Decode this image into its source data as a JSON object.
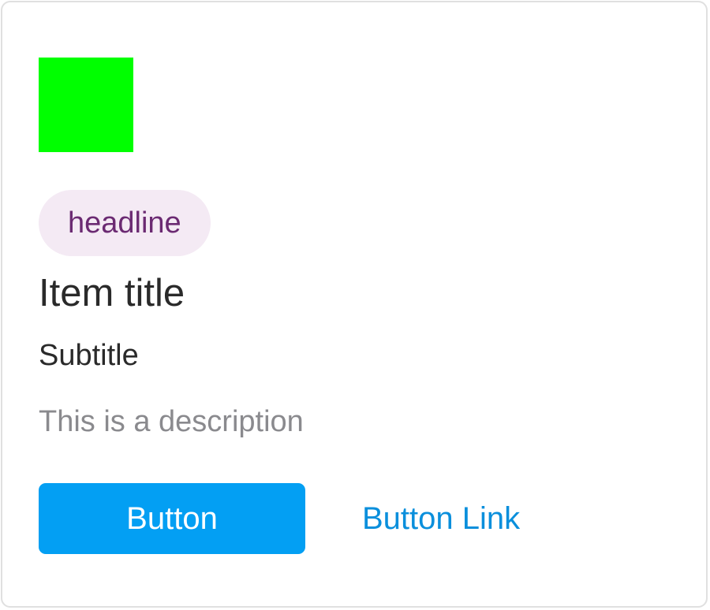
{
  "colors": {
    "thumbnail": "#00ff00",
    "chip_background": "#f4eaf4",
    "chip_text": "#6b2a72",
    "title_text": "#2a2a2a",
    "description_text": "#8a8a8e",
    "button_background": "#039ff3",
    "button_text": "#ffffff",
    "link_text": "#0a8fdc",
    "card_border": "#e0e0e0"
  },
  "card": {
    "thumbnail": "green-square-image",
    "chip_label": "headline",
    "title": "Item title",
    "subtitle": "Subtitle",
    "description": "This is a description",
    "primary_button_label": "Button",
    "link_button_label": "Button Link"
  }
}
